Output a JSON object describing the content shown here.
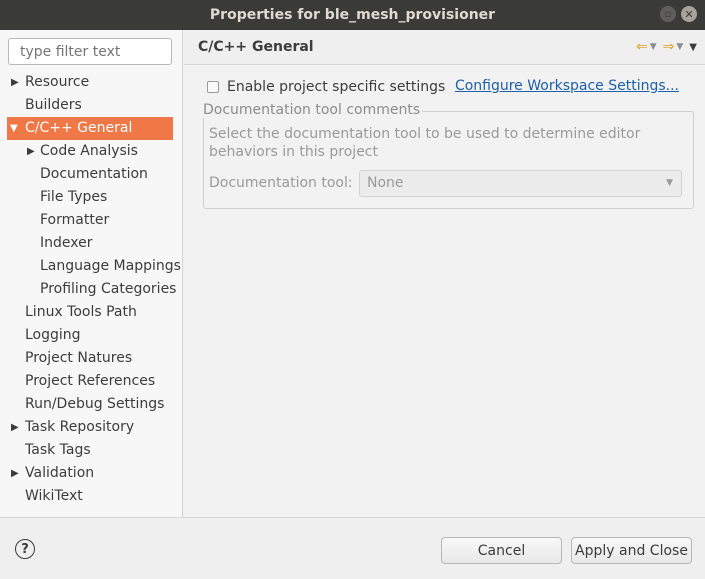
{
  "window": {
    "title": "Properties for ble_mesh_provisioner"
  },
  "filter": {
    "placeholder": "type filter text"
  },
  "tree": [
    {
      "label": "Resource",
      "expandable": true
    },
    {
      "label": "Builders"
    },
    {
      "label": "C/C++ General",
      "expanded": true,
      "selected": true
    },
    {
      "label": "Code Analysis",
      "expandable": true
    },
    {
      "label": "Documentation"
    },
    {
      "label": "File Types"
    },
    {
      "label": "Formatter"
    },
    {
      "label": "Indexer"
    },
    {
      "label": "Language Mappings"
    },
    {
      "label": "Profiling Categories"
    },
    {
      "label": "Linux Tools Path"
    },
    {
      "label": "Logging"
    },
    {
      "label": "Project Natures"
    },
    {
      "label": "Project References"
    },
    {
      "label": "Run/Debug Settings"
    },
    {
      "label": "Task Repository",
      "expandable": true
    },
    {
      "label": "Task Tags"
    },
    {
      "label": "Validation",
      "expandable": true
    },
    {
      "label": "WikiText"
    }
  ],
  "page": {
    "title": "C/C++ General",
    "enable_specific": "Enable project specific settings",
    "configure_link": "Configure Workspace Settings...",
    "group_title": "Documentation tool comments",
    "group_desc": "Select the documentation tool to be used to determine editor behaviors in this project",
    "doc_tool_label": "Documentation tool:",
    "doc_tool_value": "None"
  },
  "buttons": {
    "cancel": "Cancel",
    "apply_close": "Apply and Close"
  },
  "icons": {
    "back": "back-arrow-icon",
    "forward": "forward-arrow-icon",
    "help": "help-icon",
    "minimize": "minimize-icon",
    "close": "close-icon"
  },
  "colors": {
    "selection": "#f07746",
    "link": "#1b5fa8",
    "nav_arrow": "#e2a52f",
    "titlebar": "#3a3a37"
  }
}
